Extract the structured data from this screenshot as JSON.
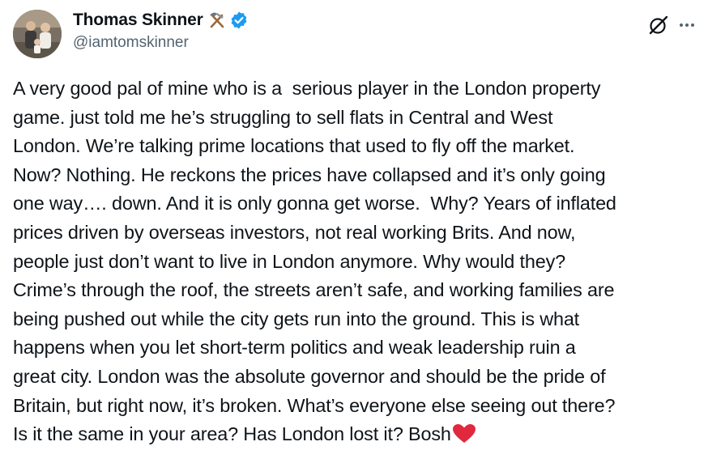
{
  "author": {
    "display_name": "Thomas Skinner",
    "handle": "@iamtomskinner",
    "name_emoji": "hammer-and-pick-icon",
    "verified_badge": "verified-icon",
    "verified_color": "#1d9bf0"
  },
  "header_actions": {
    "grok_icon": "grok-icon",
    "more_icon": "more-icon"
  },
  "tweet": {
    "lines": [
      "A very good pal of mine who is a  serious player in the London property",
      "game. just told me he’s struggling to sell flats in Central and West",
      "London. We’re talking prime locations that used to fly off the market.",
      "Now? Nothing. He reckons the prices have collapsed and it’s only going",
      "one way…. down. And it is only gonna get worse.  Why? Years of inflated",
      "prices driven by overseas investors, not real working Brits. And now,",
      "people just don’t want to live in London anymore. Why would they?",
      "Crime’s through the roof, the streets aren’t safe, and working families are",
      "being pushed out while the city gets run into the ground. This is what",
      "happens when you let short-term politics and weak leadership ruin a",
      "great city. London was the absolute governor and should be the pride of",
      "Britain, but right now, it’s broken. What’s everyone else seeing out there?",
      "Is it the same in your area? Has London lost it? Bosh"
    ],
    "trailing_emoji": "red-heart-icon"
  },
  "colors": {
    "text": "#0f1419",
    "secondary": "#536471",
    "heart": "#e0283e"
  }
}
